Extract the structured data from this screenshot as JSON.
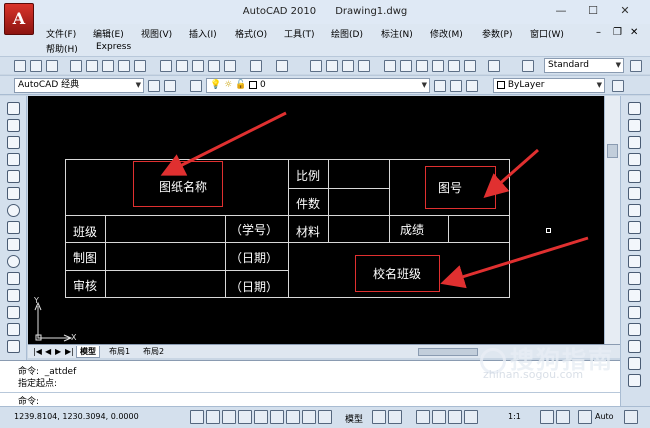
{
  "window": {
    "title": "AutoCAD 2010",
    "document": "Drawing1.dwg",
    "minimize": "—",
    "maximize": "☐",
    "close": "✕"
  },
  "menu": {
    "row1": [
      "文件(F)",
      "编辑(E)",
      "视图(V)",
      "插入(I)",
      "格式(O)",
      "工具(T)",
      "绘图(D)",
      "标注(N)",
      "修改(M)",
      "参数(P)",
      "窗口(W)"
    ],
    "row2": [
      "帮助(H)",
      "Express"
    ]
  },
  "toolbar": {
    "workspace": "AutoCAD 经典",
    "layer": "0",
    "text_style": "Standard",
    "linetype": "ByLayer"
  },
  "drawing": {
    "title_cell": "图纸名称",
    "scale_label": "比例",
    "drawing_no": "图号",
    "quantity_label": "件数",
    "class_label": "班级",
    "student_no": "（学号）",
    "material_label": "材料",
    "grade_label": "成绩",
    "draw_label": "制图",
    "date1": "（日期）",
    "school_class": "校名班级",
    "review_label": "审核",
    "date2": "（日期）",
    "axis_y": "Y",
    "axis_x": "X"
  },
  "tabs": {
    "model": "模型",
    "layout1": "布局1",
    "layout2": "布局2"
  },
  "command": {
    "line1": "命令:  _attdef",
    "line2": "指定起点:",
    "prompt": "命令:"
  },
  "status": {
    "coords": "1239.8104, 1230.3094, 0.0000",
    "model_btn": "模型",
    "scale": "1:1",
    "auto": "Auto"
  },
  "watermark": {
    "text": "搜狗指南",
    "url": "zhinan.sogou.com"
  },
  "colors": {
    "canvas": "#000000",
    "annotation": "#e03030",
    "line": "#d8d8d8"
  }
}
